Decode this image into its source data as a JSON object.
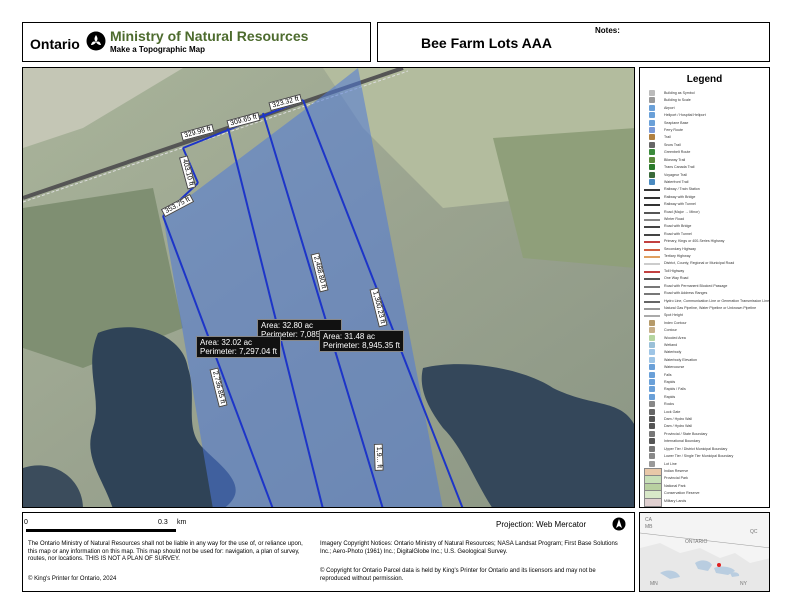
{
  "header": {
    "ontario": "Ontario",
    "ministry": "Ministry of Natural Resources",
    "subtitle": "Make a Topographic Map",
    "map_title": "Bee Farm Lots AAA",
    "notes_label": "Notes:"
  },
  "legend": {
    "title": "Legend",
    "items": [
      "Building as Symbol",
      "Building to Scale",
      "Airport",
      "Heliport / Hospital Heliport",
      "Seaplane Base",
      "Ferry Route",
      "Trail",
      "Snow Trail",
      "Greenbelt Route",
      "Bikeway Trail",
      "Trans Canada Trail",
      "Voyageur Trail",
      "Waterfront Trail",
      "Railway / Train Station",
      "Railway with Bridge",
      "Railway with Tunnel",
      "Road (Major → Minor)",
      "Winter Road",
      "Road with Bridge",
      "Road with Tunnel",
      "Primary, Kings or 400-Series Highway",
      "Secondary Highway",
      "Tertiary Highway",
      "District, County, Regional or Municipal Road",
      "Toll Highway",
      "One Way Road",
      "Road with Permanent Blocked Passage",
      "Road with Address Ranges",
      "Hydro Line, Communication Line or Generation Transmission Line",
      "Natural Gas Pipeline, Water Pipeline or Unknown Pipeline",
      "Spot Height",
      "Index Contour",
      "Contour",
      "Wooded Area",
      "Wetland",
      "Waterbody",
      "Waterbody Elevation",
      "Watercourse",
      "Falls",
      "Rapids",
      "Rapids / Falls",
      "Rapids",
      "Rocks",
      "Lock Gate",
      "Dam / Hydro Wall",
      "Dam / Hydro Wall",
      "Provincial / State Boundary",
      "International Boundary",
      "Upper Tier / District Municipal Boundary",
      "Lower Tier / Single Tier Municipal Boundary",
      "Lot Line",
      "Indian Reserve",
      "Provincial Park",
      "National Park",
      "Conservation Reserve",
      "Military Lands"
    ]
  },
  "map": {
    "lot_lines": [
      "329.98 ft",
      "309.65 ft",
      "323.32 ft",
      "403.10 ft",
      "353.75 ft",
      "2,488.80 ft",
      "1,300.23 ft",
      "2,736.85 ft",
      "1,9... ft"
    ],
    "areas": [
      {
        "area": "Area: 32.80 ac",
        "perimeter": "Perimeter: 7,085.87 ft"
      },
      {
        "area": "Area: 32.02 ac",
        "perimeter": "Perimeter: 7,297.04 ft"
      },
      {
        "area": "Area: 31.48 ac",
        "perimeter": "Perimeter: 8,945.35 ft"
      }
    ],
    "parcel_fill": "#4f78d8",
    "line_color": "#1d35c8"
  },
  "footer": {
    "scale_zero": "0",
    "scale_max": "0.3",
    "scale_unit": "km",
    "projection": "Projection: Web Mercator",
    "disclaimer": "The Ontario Ministry of Natural Resources shall not be liable in any way for the use of, or reliance upon, this map or any information on this map.  This map should not be used for: navigation, a plan of survey, routes, nor locations. THIS IS NOT A PLAN OF SURVEY.",
    "imagery": "Imagery Copyright Notices: Ontario Ministry of Natural Resources; NASA Landsat Program; First Base Solutions Inc.; Aero-Photo (1961) Inc.; DigitalGlobe Inc.; U.S. Geological Survey.",
    "parcel_copyright": "© Copyright for Ontario Parcel data is held by King's Printer for Ontario and its licensors and may not be reproduced without permission.",
    "kings": "© King's Printer for Ontario,  2024"
  },
  "inset": {
    "labels": [
      "ONTARIO",
      "CA",
      "MB",
      "QC",
      "MN",
      "NY"
    ]
  }
}
